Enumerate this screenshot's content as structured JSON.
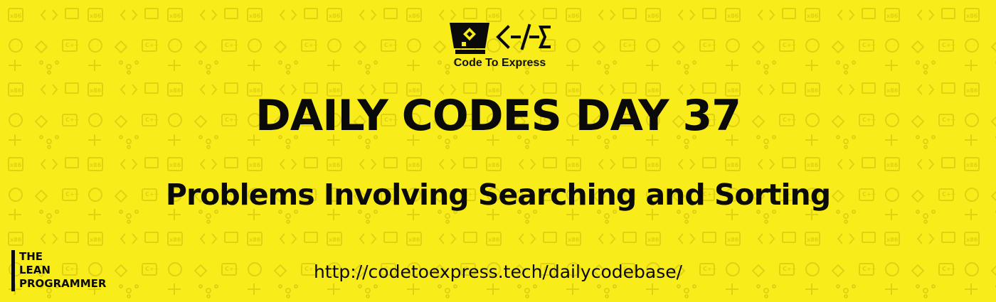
{
  "logo": {
    "brand_name": "Code To Express",
    "mark_icon": "code-to-express-logo-icon",
    "glyph_text": "<-/-Σ"
  },
  "title": "DAILY CODES DAY 37",
  "subtitle": "Problems Involving Searching and Sorting",
  "url": "http://codetoexpress.tech/dailycodebase/",
  "corner_brand": {
    "line1": "THE",
    "line2": "LEAN",
    "line3": "PROGRAMMER"
  },
  "colors": {
    "background": "#f9ec1b",
    "pattern": "#e3d515",
    "text": "#0a0a0a"
  }
}
